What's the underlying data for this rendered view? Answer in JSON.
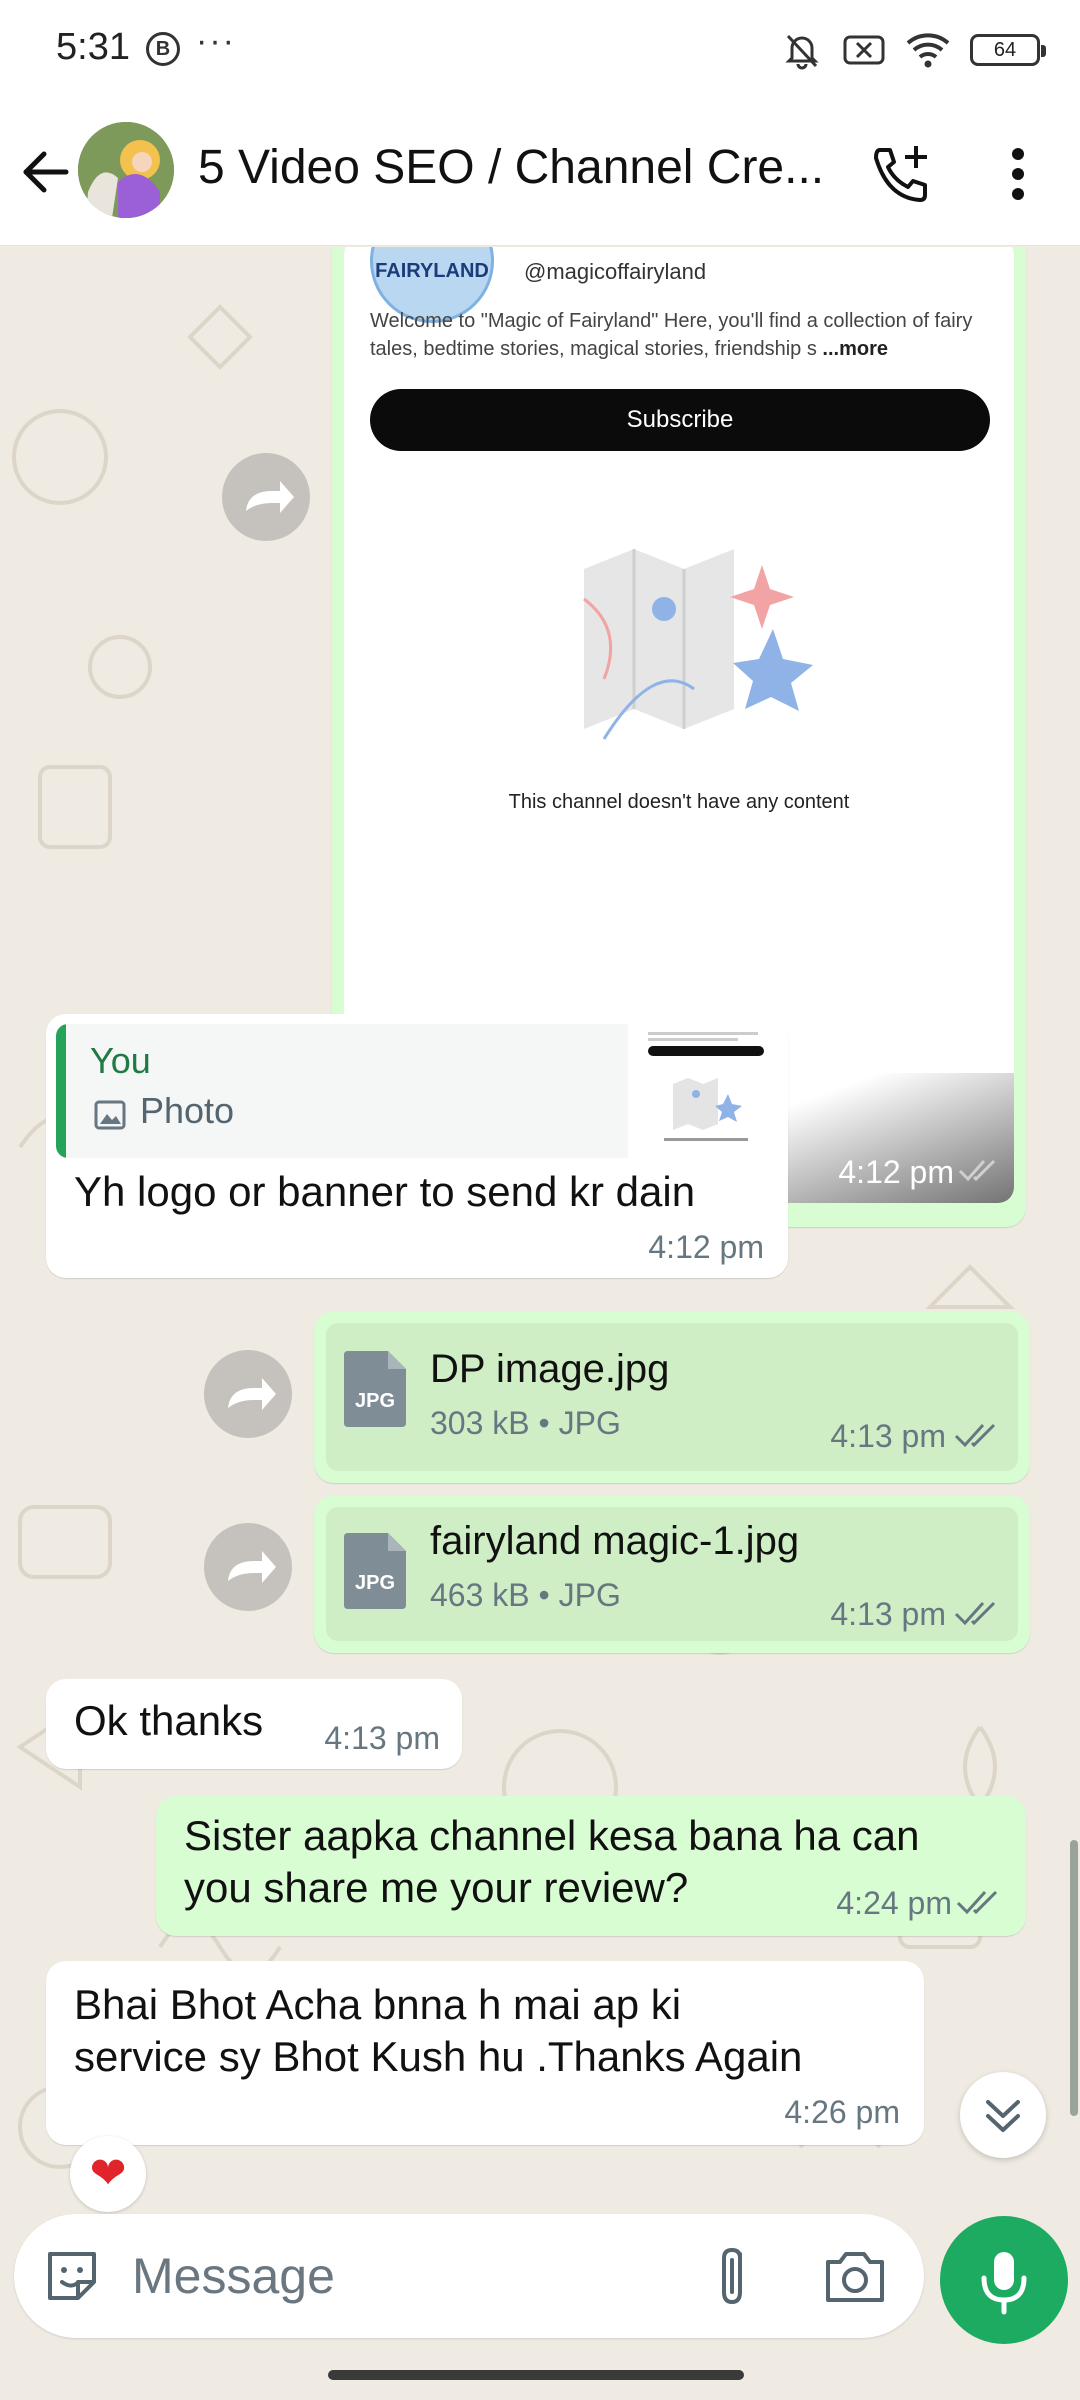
{
  "status_bar": {
    "time": "5:31",
    "left_badge": "B",
    "overflow": "···",
    "battery": "64",
    "icons": [
      "mute-bell-icon",
      "no-sim-icon",
      "wifi-icon",
      "battery-icon"
    ]
  },
  "header": {
    "title": "5 Video SEO / Channel Cre...",
    "icons": [
      "back-arrow-icon",
      "add-call-icon",
      "more-vert-icon"
    ]
  },
  "channel_card": {
    "logo_text": "FAIRYLAND",
    "handle": "@magicoffairyland",
    "description": "Welcome to \"Magic of Fairyland\" Here, you'll find a collection of fairy tales, bedtime stories, magical stories, friendship s",
    "more": "...more",
    "subscribe": "Subscribe",
    "no_content": "This channel doesn't have any content",
    "time": "4:12 pm"
  },
  "messages": {
    "reply_msg": {
      "quoted_name": "You",
      "quoted_type": "Photo",
      "text": "Yh logo or banner to send kr dain",
      "time": "4:12 pm"
    },
    "file1": {
      "name": "DP image.jpg",
      "meta": "303 kB • JPG",
      "ext": "JPG",
      "time": "4:13 pm"
    },
    "file2": {
      "name": "fairyland magic-1.jpg",
      "meta": "463 kB • JPG",
      "ext": "JPG",
      "time": "4:13 pm"
    },
    "ok": {
      "text": "Ok thanks",
      "time": "4:13 pm"
    },
    "out_question": {
      "line1": "Sister aapka channel kesa bana ha can",
      "line2": "you share me your review?",
      "time": "4:24 pm"
    },
    "review": {
      "line1": "Bhai Bhot Acha bnna h mai ap ki",
      "line2": "service sy Bhot Kush hu .Thanks Again",
      "time": "4:26 pm"
    },
    "reaction": "❤"
  },
  "composer": {
    "placeholder": "Message"
  },
  "colors": {
    "outgoing": "#d9fdd3",
    "incoming": "#ffffff",
    "accent_green": "#1daa61",
    "background": "#efeae2"
  }
}
